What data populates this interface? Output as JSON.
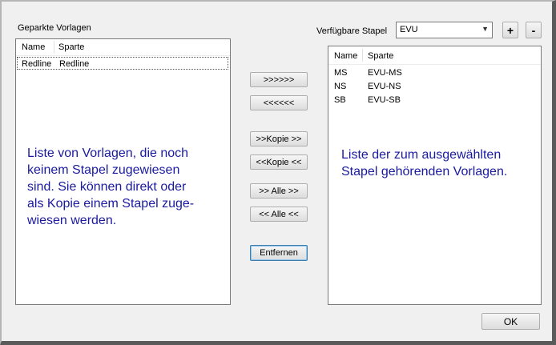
{
  "parked": {
    "title": "Geparkte Vorlagen",
    "columns": [
      "Name",
      "Sparte"
    ],
    "rows": [
      {
        "name": "Redline",
        "sparte": "Redline"
      }
    ],
    "hint": "Liste von Vorlagen, die noch\nkeinem Stapel zugewiesen\nsind. Sie können direkt oder\nals Kopie einem Stapel zuge-\nwiesen werden."
  },
  "stack": {
    "label": "Verfügbare Stapel",
    "selected": "EVU",
    "add_label": "+",
    "remove_label": "-",
    "columns": [
      "Name",
      "Sparte"
    ],
    "rows": [
      {
        "name": "MS",
        "sparte": "EVU-MS"
      },
      {
        "name": "NS",
        "sparte": "EVU-NS"
      },
      {
        "name": "SB",
        "sparte": "EVU-SB"
      }
    ],
    "hint": "Liste der zum ausgewählten\nStapel gehörenden Vorlagen."
  },
  "buttons": {
    "move_right": ">>>>>>",
    "move_left": "<<<<<<",
    "copy_right": ">>Kopie >>",
    "copy_left": "<<Kopie <<",
    "all_right": ">> Alle >>",
    "all_left": "<< Alle <<",
    "remove": "Entfernen",
    "ok": "OK"
  },
  "icons": {
    "dropdown": "chevron-down-icon"
  }
}
